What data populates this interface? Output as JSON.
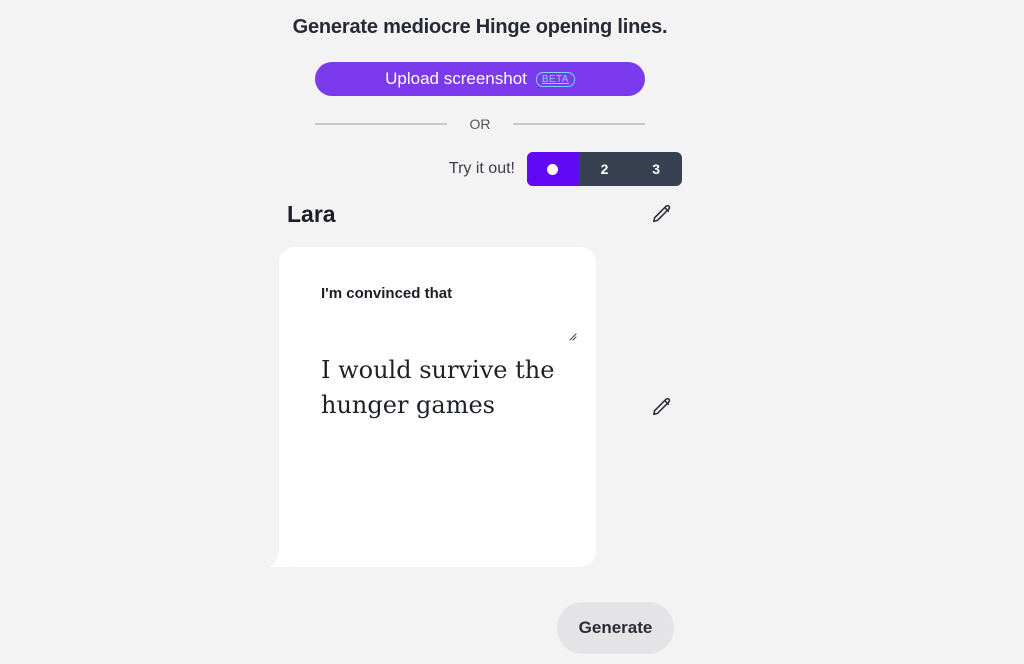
{
  "header": {
    "title": "Generate mediocre Hinge opening lines."
  },
  "upload": {
    "label": "Upload screenshot",
    "badge": "BETA"
  },
  "divider": {
    "label": "OR"
  },
  "try": {
    "label": "Try it out!",
    "options": [
      "",
      "2",
      "3"
    ],
    "selected_index": 0
  },
  "profile": {
    "name": "Lara",
    "prompt": "I'm convinced that",
    "answer": "I would survive the hunger games"
  },
  "actions": {
    "generate_label": "Generate"
  },
  "icons": {
    "edit_name": "pencil-icon",
    "edit_answer": "pencil-icon",
    "selected_dot": "dot-icon",
    "resize": "resize-handle-icon"
  },
  "colors": {
    "accent": "#7c3aed",
    "segment_active": "#6109f5",
    "segment_bg": "#374151",
    "beta": "#7dd3fc",
    "background": "#f3f3f3"
  }
}
